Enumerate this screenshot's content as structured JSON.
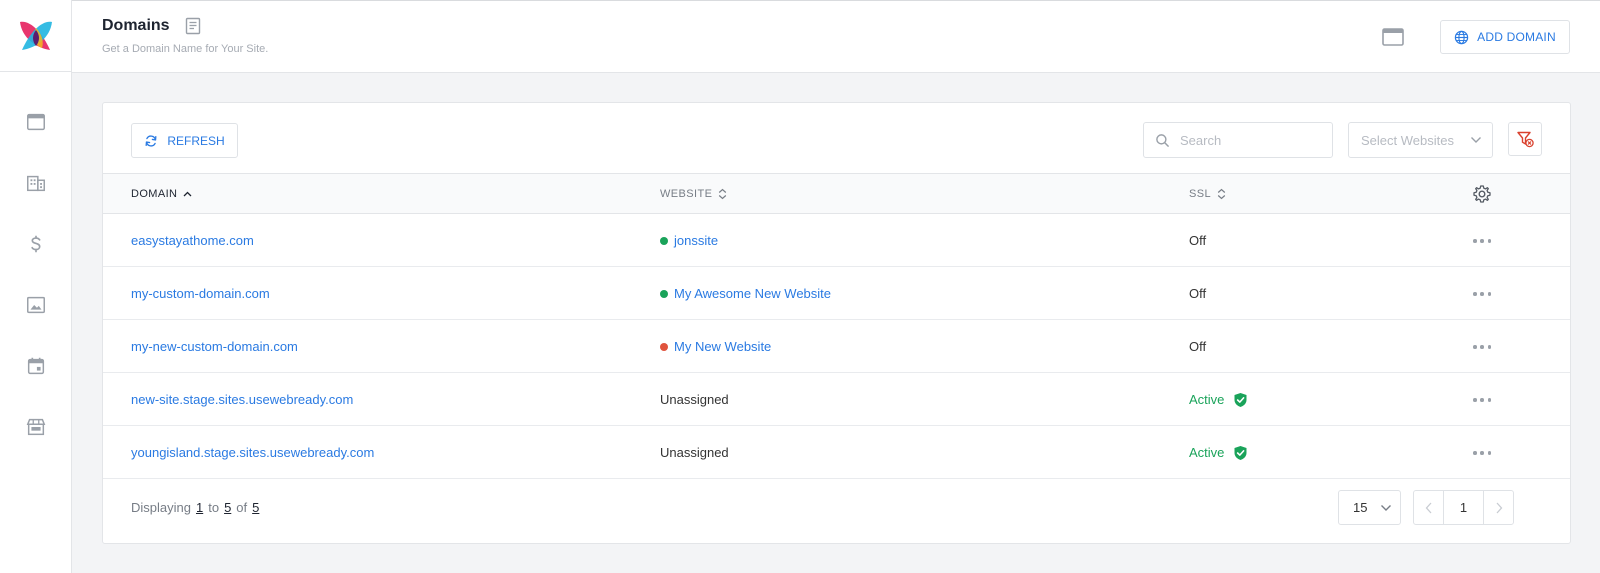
{
  "header": {
    "title": "Domains",
    "subtitle": "Get a Domain Name for Your Site.",
    "add_domain_label": "ADD DOMAIN"
  },
  "sidebar": {
    "items": [
      {
        "icon": "window-icon"
      },
      {
        "icon": "building-icon"
      },
      {
        "icon": "dollar-icon"
      },
      {
        "icon": "image-icon"
      },
      {
        "icon": "calendar-icon"
      },
      {
        "icon": "store-icon"
      }
    ]
  },
  "toolbar": {
    "refresh_label": "REFRESH",
    "search_placeholder": "Search",
    "select_websites_placeholder": "Select Websites"
  },
  "table": {
    "columns": {
      "domain": "DOMAIN",
      "website": "WEBSITE",
      "ssl": "SSL"
    },
    "rows": [
      {
        "domain": "easystayathome.com",
        "website": "jonssite",
        "website_status": "online",
        "ssl": "Off"
      },
      {
        "domain": "my-custom-domain.com",
        "website": "My Awesome New Website",
        "website_status": "online",
        "ssl": "Off"
      },
      {
        "domain": "my-new-custom-domain.com",
        "website": "My New Website",
        "website_status": "offline",
        "ssl": "Off"
      },
      {
        "domain": "new-site.stage.sites.usewebready.com",
        "website": "Unassigned",
        "website_status": "none",
        "ssl": "Active"
      },
      {
        "domain": "youngisland.stage.sites.usewebready.com",
        "website": "Unassigned",
        "website_status": "none",
        "ssl": "Active"
      }
    ]
  },
  "footer": {
    "displaying": "Displaying",
    "to": "to",
    "of": "of",
    "from": "1",
    "until": "5",
    "total": "5",
    "per_page": "15",
    "current_page": "1"
  },
  "colors": {
    "accent": "#2a7ae2",
    "online": "#1aa35a",
    "offline": "#e0533d",
    "filter": "#d9412e"
  }
}
